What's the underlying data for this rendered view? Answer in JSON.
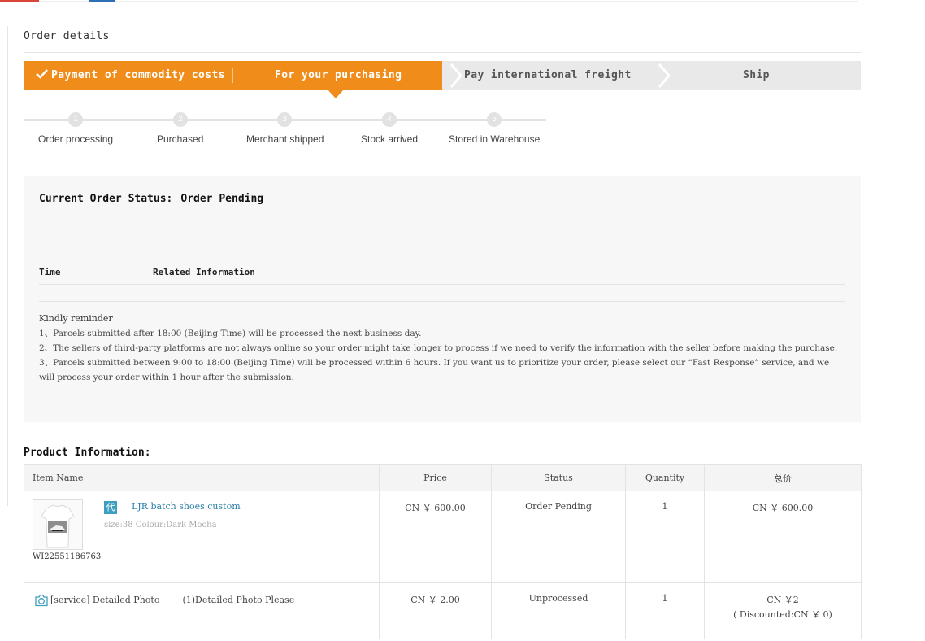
{
  "page": {
    "title": "Order details"
  },
  "steps": [
    {
      "label": "Payment of commodity costs",
      "state": "done"
    },
    {
      "label": "For your purchasing",
      "state": "current"
    },
    {
      "label": "Pay international freight",
      "state": "pending"
    },
    {
      "label": "Ship",
      "state": "pending"
    }
  ],
  "progress": [
    {
      "num": "1",
      "label": "Order processing"
    },
    {
      "num": "2",
      "label": "Purchased"
    },
    {
      "num": "3",
      "label": "Merchant shipped"
    },
    {
      "num": "4",
      "label": "Stock arrived"
    },
    {
      "num": "5",
      "label": "Stored in Warehouse"
    }
  ],
  "status": {
    "label": "Current Order Status:",
    "value": "Order Pending",
    "col_time": "Time",
    "col_related": "Related Information"
  },
  "reminder": {
    "heading": "Kindly reminder",
    "items": [
      "1、Parcels submitted after 18:00 (Beijing Time) will be processed the next business day.",
      "2、The sellers of third-party platforms are not always online so your order might take longer to process if we need to verify the information with the seller before making the purchase.",
      "3、Parcels submitted between 9:00 to 18:00 (Beijing Time) will be processed within 6 hours. If you want us to prioritize your order, please select our “Fast Response” service, and we will process your order within 1 hour after the submission."
    ]
  },
  "product": {
    "section_title": "Product Information:",
    "columns": [
      "Item Name",
      "Price",
      "Status",
      "Quantity",
      "总价"
    ],
    "item": {
      "badge": "代",
      "name": "LJR batch shoes custom",
      "attrs": "size:38 Colour:Dark Mocha",
      "sku": "WI22551186763",
      "price": "CN ￥ 600.00",
      "status": "Order Pending",
      "quantity": "1",
      "total": "CN ￥ 600.00"
    },
    "service": {
      "icon": "camera-icon",
      "name": "[service] Detailed Photo",
      "note": "(1)Detailed Photo Please",
      "price": "CN ￥ 2.00",
      "status": "Unprocessed",
      "quantity": "1",
      "total": "CN ￥2",
      "discount": "( Discounted:CN ￥ 0)"
    }
  },
  "colors": {
    "accent": "#f08c1a",
    "link": "#2a7fa8",
    "badge": "#3d9fbf"
  }
}
